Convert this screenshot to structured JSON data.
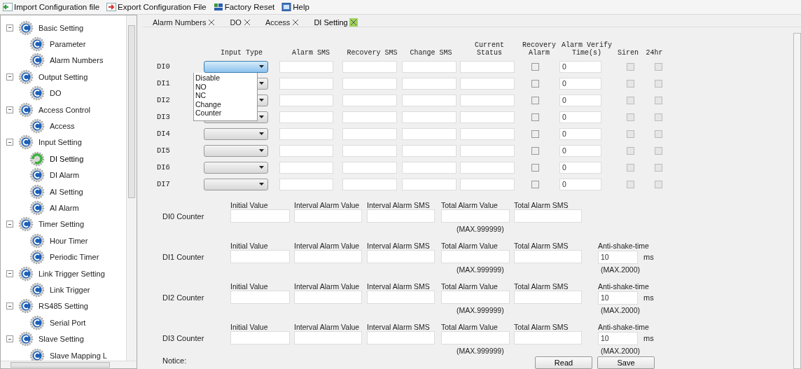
{
  "toolbar": [
    {
      "label": "Import Configuration file",
      "kind": "import"
    },
    {
      "label": "Export Configuration File",
      "kind": "export"
    },
    {
      "label": "Factory Reset",
      "kind": "reset"
    },
    {
      "label": "Help",
      "kind": "help"
    }
  ],
  "sidebar": {
    "items": [
      {
        "label": "Basic Setting",
        "expanded": true,
        "selected": false,
        "children": [
          {
            "label": "Parameter",
            "selected": false
          },
          {
            "label": "Alarm Numbers",
            "selected": false
          }
        ]
      },
      {
        "label": "Output Setting",
        "expanded": true,
        "selected": false,
        "children": [
          {
            "label": "DO",
            "selected": false
          }
        ]
      },
      {
        "label": "Access Control",
        "expanded": true,
        "selected": false,
        "children": [
          {
            "label": "Access",
            "selected": false
          }
        ]
      },
      {
        "label": "Input Setting",
        "expanded": true,
        "selected": false,
        "children": [
          {
            "label": "DI Setting",
            "selected": true
          },
          {
            "label": "DI Alarm",
            "selected": false
          },
          {
            "label": "AI  Setting",
            "selected": false
          },
          {
            "label": "AI Alarm",
            "selected": false
          }
        ]
      },
      {
        "label": "Timer Setting",
        "expanded": true,
        "selected": false,
        "children": [
          {
            "label": "Hour Timer",
            "selected": false
          },
          {
            "label": "Periodic Timer",
            "selected": false
          }
        ]
      },
      {
        "label": "Link Trigger Setting",
        "expanded": true,
        "selected": false,
        "children": [
          {
            "label": "Link Trigger",
            "selected": false
          }
        ]
      },
      {
        "label": "RS485 Setting",
        "expanded": true,
        "selected": false,
        "children": [
          {
            "label": "Serial Port",
            "selected": false
          }
        ]
      },
      {
        "label": "Slave Setting",
        "expanded": true,
        "selected": false,
        "children": [
          {
            "label": "Slave Mapping L",
            "selected": false
          }
        ]
      }
    ]
  },
  "tabs": [
    {
      "label": "Alarm Numbers",
      "selected": false
    },
    {
      "label": "DO",
      "selected": false
    },
    {
      "label": "Access",
      "selected": false
    },
    {
      "label": "DI Setting",
      "selected": true
    }
  ],
  "di_table": {
    "columns": [
      "Input Type",
      "Alarm SMS",
      "Recovery SMS",
      "Change SMS",
      "Current\nStatus",
      "Recovery\nAlarm",
      "Alarm Verify\nTime(s)",
      "Siren",
      "24hr"
    ],
    "rows": [
      {
        "label": "DI0",
        "input_type": {
          "open": true,
          "options": [
            "Disable",
            "NO",
            "NC",
            "Change",
            "Counter"
          ]
        },
        "recovery_alarm": {
          "checked": false,
          "disabled": false
        },
        "verify_time": "0",
        "siren": {
          "checked": false,
          "disabled": true
        },
        "h24": {
          "checked": false,
          "disabled": true
        }
      },
      {
        "label": "DI1",
        "input_type": {
          "open": false
        },
        "recovery_alarm": {
          "checked": false,
          "disabled": false
        },
        "verify_time": "0",
        "siren": {
          "checked": false,
          "disabled": true
        },
        "h24": {
          "checked": false,
          "disabled": true
        }
      },
      {
        "label": "DI2",
        "input_type": {
          "open": false
        },
        "recovery_alarm": {
          "checked": false,
          "disabled": false
        },
        "verify_time": "0",
        "siren": {
          "checked": false,
          "disabled": true
        },
        "h24": {
          "checked": false,
          "disabled": true
        }
      },
      {
        "label": "DI3",
        "input_type": {
          "open": false
        },
        "recovery_alarm": {
          "checked": false,
          "disabled": false
        },
        "verify_time": "0",
        "siren": {
          "checked": false,
          "disabled": true
        },
        "h24": {
          "checked": false,
          "disabled": true
        }
      },
      {
        "label": "DI4",
        "input_type": {
          "open": false
        },
        "recovery_alarm": {
          "checked": false,
          "disabled": false
        },
        "verify_time": "0",
        "siren": {
          "checked": false,
          "disabled": true
        },
        "h24": {
          "checked": false,
          "disabled": true
        }
      },
      {
        "label": "DI5",
        "input_type": {
          "open": false
        },
        "recovery_alarm": {
          "checked": false,
          "disabled": false
        },
        "verify_time": "0",
        "siren": {
          "checked": false,
          "disabled": true
        },
        "h24": {
          "checked": false,
          "disabled": true
        }
      },
      {
        "label": "DI6",
        "input_type": {
          "open": false
        },
        "recovery_alarm": {
          "checked": false,
          "disabled": false
        },
        "verify_time": "0",
        "siren": {
          "checked": false,
          "disabled": true
        },
        "h24": {
          "checked": false,
          "disabled": true
        }
      },
      {
        "label": "DI7",
        "input_type": {
          "open": false
        },
        "recovery_alarm": {
          "checked": false,
          "disabled": false
        },
        "verify_time": "0",
        "siren": {
          "checked": false,
          "disabled": true
        },
        "h24": {
          "checked": false,
          "disabled": true
        }
      }
    ]
  },
  "counters": [
    {
      "label": "DI0 Counter",
      "fields": [
        "Initial Value",
        "Interval Alarm Value",
        "Interval Alarm SMS",
        "Total Alarm Value",
        "Total Alarm SMS"
      ],
      "total_max": "(MAX.999999)"
    },
    {
      "label": "DI1 Counter",
      "fields": [
        "Initial Value",
        "Interval Alarm  Value",
        "Interval Alarm  SMS",
        "Total Alarm Value",
        "Total Alarm SMS"
      ],
      "total_max": "(MAX.999999)",
      "anti_shake": {
        "label": "Anti-shake-time",
        "value": "10",
        "unit": "ms",
        "max": "(MAX.2000)"
      }
    },
    {
      "label": "DI2 Counter",
      "fields": [
        "Initial Value",
        "Interval Alarm  Value",
        "Interval Alarm  SMS",
        "Total Alarm Value",
        "Total Alarm SMS"
      ],
      "total_max": "(MAX.999999)",
      "anti_shake": {
        "label": "Anti-shake-time",
        "value": "10",
        "unit": "ms",
        "max": "(MAX.2000)"
      }
    },
    {
      "label": "DI3 Counter",
      "fields": [
        "Initial Value",
        "Interval Alarm  Value",
        "Interval Alarm  SMS",
        "Total Alarm Value",
        "Total Alarm SMS"
      ],
      "total_max": "(MAX.999999)",
      "anti_shake": {
        "label": "Anti-shake-time",
        "value": "10",
        "unit": "ms",
        "max": "(MAX.2000)"
      }
    }
  ],
  "notice": "Notice:",
  "buttons": [
    "Read",
    "Save"
  ]
}
